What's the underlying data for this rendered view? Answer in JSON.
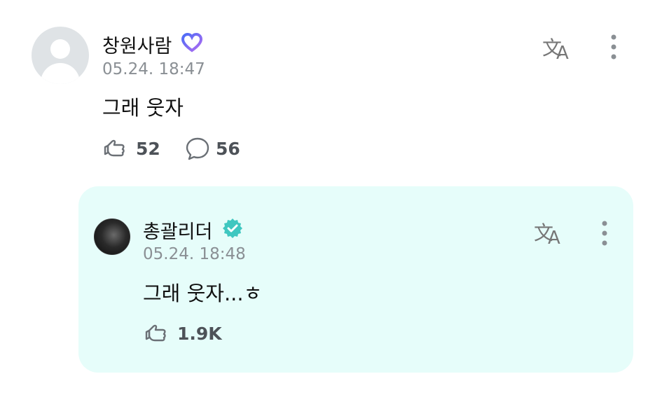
{
  "post": {
    "author": "창원사람",
    "date": "05.24. 18:47",
    "text": "그래 웃자",
    "like_count": "52",
    "comment_count": "56",
    "badge_color": "#7b6cf0"
  },
  "reply": {
    "author": "총괄리더",
    "date": "05.24. 18:48",
    "text": "그래 웃자...ㅎ",
    "like_count": "1.9K",
    "badge_color": "#3fc7c0",
    "background": "#e6fdfa"
  },
  "icons": {
    "translate": "translate-icon",
    "more": "more-vertical-icon",
    "like": "like-hand-icon",
    "comment": "comment-bubble-icon",
    "verified": "verified-badge-icon"
  }
}
